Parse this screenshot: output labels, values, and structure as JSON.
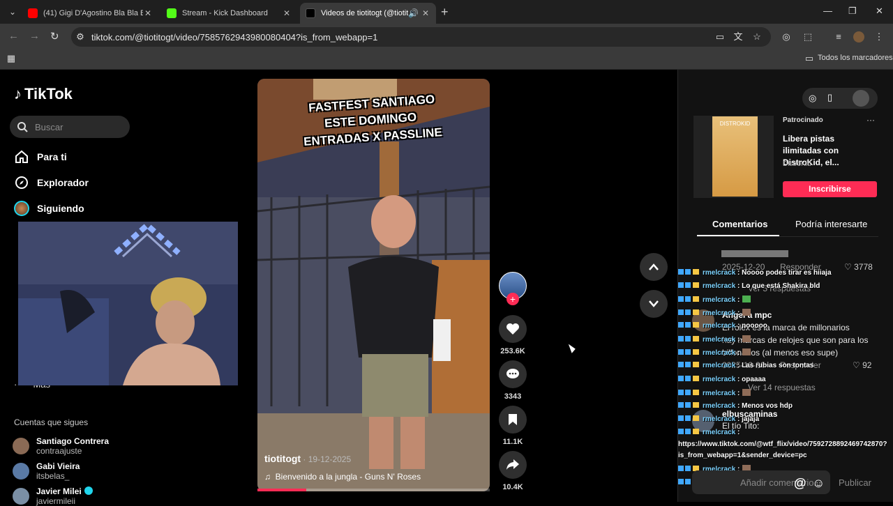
{
  "browser": {
    "tabs": [
      {
        "title": "(41) Gigi D'Agostino Bla Bla Bla",
        "favicon": "youtube-icon",
        "color": "#ff0000"
      },
      {
        "title": "Stream - Kick Dashboard",
        "favicon": "kick-icon",
        "color": "#53fc18"
      },
      {
        "title": "Videos de tiotitogt (@tiotito",
        "favicon": "tiktok-icon",
        "color": "#000000",
        "active": true
      }
    ],
    "url": "tiktok.com/@tiotitogt/video/7585762943980080404?is_from_webapp=1",
    "bookmarks_label": "Todos los marcadores"
  },
  "sidebar": {
    "logo": "TikTok",
    "search_placeholder": "Buscar",
    "nav": [
      {
        "label": "Para ti",
        "icon": "home-icon"
      },
      {
        "label": "Explorador",
        "icon": "compass-icon"
      },
      {
        "label": "Siguiendo",
        "icon": "following-avatar-icon"
      }
    ],
    "more_label": "Más",
    "following_title": "Cuentas que sigues",
    "accounts": [
      {
        "name": "Santiago Contrera",
        "handle": "contraajuste"
      },
      {
        "name": "Gabi Vieira",
        "handle": "itsbelas_"
      },
      {
        "name": "Javier Milei",
        "handle": "javiermileii",
        "verified": true
      }
    ]
  },
  "video": {
    "overlay_lines": [
      "FASTFEST SANTIAGO",
      "ESTE DOMINGO",
      "ENTRADAS X PASSLINE"
    ],
    "author": "tiotitogt",
    "date": " · 19-12-2025",
    "music": "Bienvenido a la jungla - Guns N' Roses",
    "progress": 0.21,
    "likes": "253.6K",
    "comments": "3343",
    "saves": "11.1K",
    "shares": "10.4K"
  },
  "right": {
    "ad": {
      "sponsored": "Patrocinado",
      "title": "Libera pistas ilimitadas con DistroKid, el...",
      "brand": "DistroKid",
      "art_label": "DISTROKID",
      "button": "Inscribirse"
    },
    "tabs": [
      "Comentarios",
      "Podría interesarte"
    ],
    "comments": {
      "c1_date": "2025-12-20",
      "c1_reply": "Responder",
      "c1_likes": "3778",
      "c1_replies": "Ver 5 respuestas",
      "c2_user": "Angel a mpc",
      "c2_text1": "El rolex es la marca de millonarios",
      "c2_text2": "hay marcas de relojes que son para los",
      "c2_text3": "billonarios (al menos eso supe)",
      "c2_date": "2025-12-20",
      "c2_reply": "Responder",
      "c2_likes": "92",
      "c2_replies": "Ver 14 respuestas",
      "c3_user": "elbuscaminas",
      "c3_text": "El tío Tito:",
      "input_placeholder": "Añadir comentario...",
      "post": "Publicar"
    },
    "chat": [
      {
        "user": "rmelcrack",
        "msg": ": Noooo podes tirar es hiiaja"
      },
      {
        "user": "rmelcrack",
        "msg": ": Lo que está Shakira bld"
      },
      {
        "user": "rmelcrack",
        "msg": ":",
        "emote": true
      },
      {
        "user": "rmelcrack",
        "msg": ":",
        "emote": true
      },
      {
        "user": "rmelcrack",
        "msg": ": nooooo"
      },
      {
        "user": "rmelcrack",
        "msg": ":",
        "emote": true
      },
      {
        "user": "rmelcrack",
        "msg": ":",
        "emote": true
      },
      {
        "user": "rmelcrack",
        "msg": ": Las rubias son tontas"
      },
      {
        "user": "rmelcrack",
        "msg": ": opaaaa"
      },
      {
        "user": "rmelcrack",
        "msg": ":",
        "emote": true
      },
      {
        "user": "rmelcrack",
        "msg": ": Menos vos hdp"
      },
      {
        "user": "rmelcrack",
        "msg": ": jajaja"
      },
      {
        "user": "rmelcrack",
        "msg": ":"
      }
    ],
    "chat_link1": "https://www.tiktok.com/@wtf_flix/video/7592728892469742870?",
    "chat_link2": "is_from_webapp=1&sender_device=pc",
    "chat_tail": [
      {
        "user": "rmelcrack",
        "msg": ":",
        "emote": true
      },
      {
        "user": "rmelcrack",
        "msg": ":",
        "emote": true
      }
    ]
  }
}
